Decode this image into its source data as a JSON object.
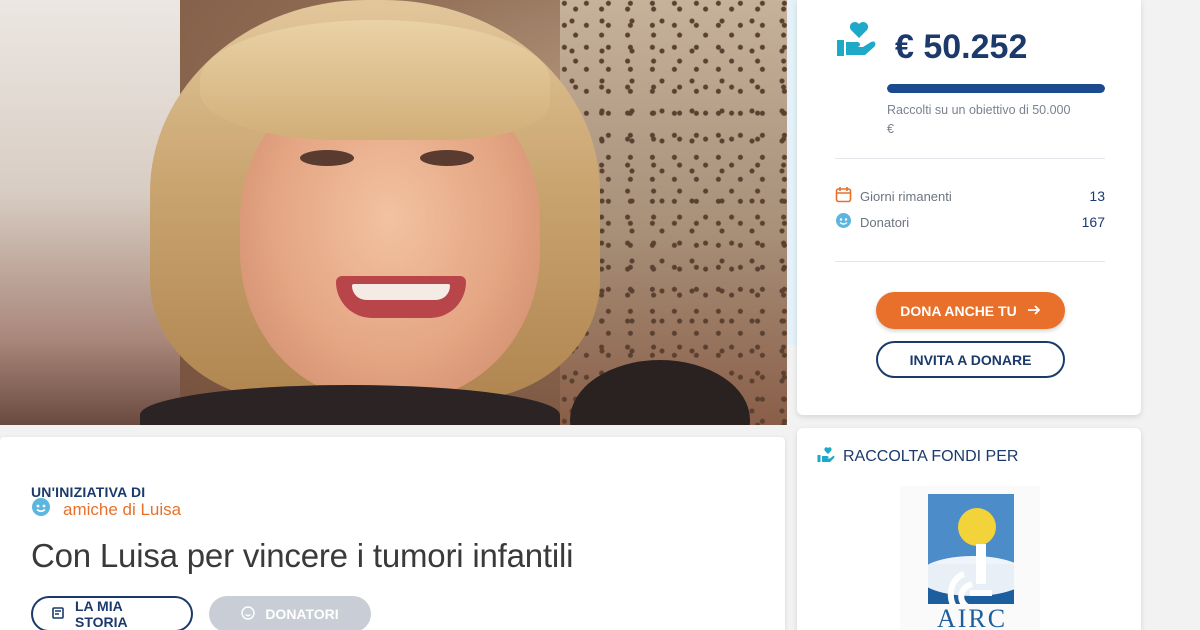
{
  "colors": {
    "brand": "#1b3a6b",
    "accent": "#e8702a",
    "muted": "#7a8290"
  },
  "hero": {
    "alt_icon": "campaign-photo"
  },
  "campaign": {
    "kicker": "UN'INIZIATIVA DI",
    "author": "amiche di Luisa",
    "title": "Con Luisa per vincere i tumori infantili",
    "tabs": [
      {
        "label": "LA MIA STORIA",
        "icon": "story-icon",
        "active": true
      },
      {
        "label": "DONATORI",
        "icon": "smiley-icon",
        "active": false
      }
    ]
  },
  "donation": {
    "amount": "€ 50.252",
    "progress": 1.0,
    "goal_text": "Raccolti su un obiettivo di 50.000 €",
    "stats": [
      {
        "label": "Giorni rimanenti",
        "value": "13",
        "icon": "calendar-icon"
      },
      {
        "label": "Donatori",
        "value": "167",
        "icon": "smiley-icon"
      }
    ],
    "cta_label": "DONA ANCHE TU",
    "invite_label": "INVITA A DONARE"
  },
  "beneficiary": {
    "heading": "RACCOLTA FONDI PER",
    "logo_text": "AIRC"
  }
}
